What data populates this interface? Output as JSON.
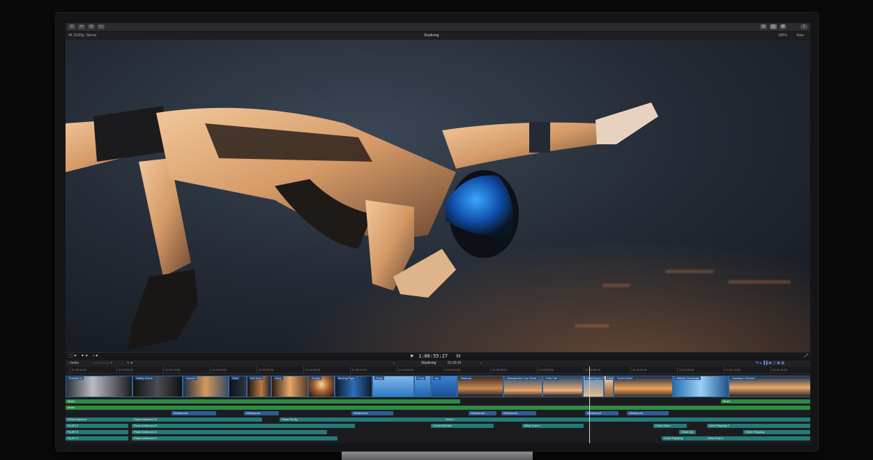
{
  "toolbar": {
    "app_buttons": [
      "≡",
      "⇐",
      "◎",
      "▭"
    ],
    "right_buttons": [
      "▤",
      "▥",
      "▦",
      "⇪"
    ]
  },
  "infobar": {
    "left_text": "4K 25/25p, Stereo",
    "title": "Skydiving",
    "zoom": "300%",
    "view_menu": "View"
  },
  "transport": {
    "timecode": "1:00:55:27"
  },
  "timeline_header": {
    "index_label": "Index",
    "project_name": "Skydiving",
    "duration": "01:00:16"
  },
  "ruler": {
    "ticks": [
      "01:00:00:00",
      "01:00:05:00",
      "01:00:10:00",
      "01:00:15:00",
      "01:00:20:00",
      "01:00:25:00",
      "01:00:30:00",
      "01:00:35:00",
      "01:00:40:00",
      "01:00:45:00",
      "01:00:50:00",
      "01:00:55:00",
      "01:01:00:00",
      "01:01:05:00",
      "01:01:10:00",
      "01:01:15:00"
    ]
  },
  "clips": [
    {
      "label": "Freefall 03"
    },
    {
      "label": "Safety Check"
    },
    {
      "label": "Launch"
    },
    {
      "label": "Gear"
    },
    {
      "label": "Exit Door"
    },
    {
      "label": "Jump"
    },
    {
      "label": "Sunset"
    },
    {
      "label": "Moving Flight"
    },
    {
      "label": "Plane"
    },
    {
      "label": "Float"
    },
    {
      "label": "Sky"
    },
    {
      "label": "Warmup"
    },
    {
      "label": "Atmospheric Low Cloud"
    },
    {
      "label": "Free Fall"
    },
    {
      "label": "Reaching to Fly"
    },
    {
      "label": "Hold"
    },
    {
      "label": "Touch Down"
    },
    {
      "label": "Altitude Clearscale"
    },
    {
      "label": "Landing in Sunset"
    }
  ],
  "tracks": {
    "music_row": [
      "Music",
      "Music"
    ],
    "music_row2": [
      "Music"
    ],
    "blue_row": [
      "Windsound",
      "Windsound",
      "Windsound",
      "Windsound",
      "Windsound",
      "Windsound",
      "Windsound"
    ],
    "teal_row1": [
      "Wind Ambience",
      "Plane Ambience B",
      "Plane Fly By",
      "Wind 1"
    ],
    "teal_row2": [
      "Fly BY 5",
      "Plane Ambience B",
      "Crowd Mumble",
      "Wind Gust 4",
      "Chute Open",
      "Gear Flapping 3"
    ],
    "teal_row3": [
      "Fly BY 5",
      "Plane Ambience D",
      "Chute Zip",
      "Chute Flapping"
    ],
    "teal_row4": [
      "Fly BY 2",
      "Plane Ambience D",
      "Chute Flapping",
      "Wind Gust 4"
    ]
  },
  "colors": {
    "music": "#2f8a43",
    "sfx": "#2f5c99",
    "ambience": "#257a7a"
  }
}
